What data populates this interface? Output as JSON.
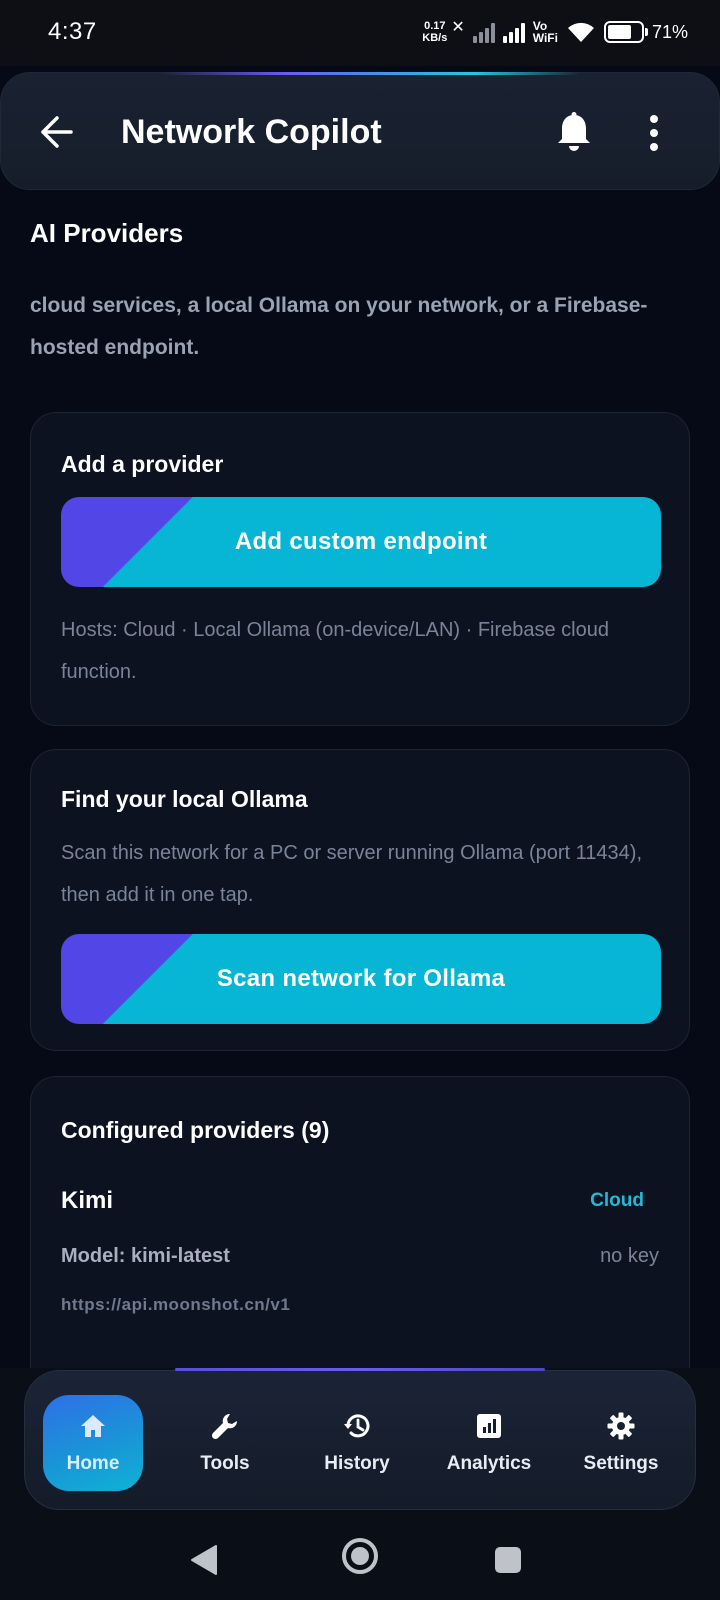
{
  "status_bar": {
    "time": "4:37",
    "net_speed_value": "0.17",
    "net_speed_unit": "KB/s",
    "vowifi_top": "Vo",
    "vowifi_bottom": "WiFi",
    "battery_percent": "71%",
    "battery_level": 0.71
  },
  "app_bar": {
    "title": "Network Copilot",
    "icons": [
      "back-arrow-icon",
      "bell-icon",
      "more-vert-icon"
    ]
  },
  "providers": {
    "section_title": "AI Providers",
    "intro": "cloud services, a local Ollama on your network, or a Firebase-hosted endpoint."
  },
  "add_card": {
    "title": "Add a provider",
    "button_label": "Add custom endpoint",
    "note": "Hosts: Cloud · Local Ollama (on-device/LAN) · Firebase cloud function."
  },
  "ollama_card": {
    "title": "Find your local Ollama",
    "note": "Scan this network for a PC or server running Ollama (port 11434), then add it in one tap.",
    "button_label": "Scan network for Ollama"
  },
  "configured": {
    "title": "Configured providers (9)",
    "items": [
      {
        "name": "Kimi",
        "badge": "Cloud",
        "model": "Model: kimi-latest",
        "key_status": "no key",
        "url": "https://api.moonshot.cn/v1"
      }
    ]
  },
  "bottom_nav": {
    "items": [
      {
        "label": "Home",
        "icon": "home-icon",
        "active": true
      },
      {
        "label": "Tools",
        "icon": "wrench-icon",
        "active": false
      },
      {
        "label": "History",
        "icon": "history-icon",
        "active": false
      },
      {
        "label": "Analytics",
        "icon": "analytics-icon",
        "active": false
      },
      {
        "label": "Settings",
        "icon": "gear-icon",
        "active": false
      }
    ]
  },
  "colors": {
    "background": "#050a16",
    "accent_cyan": "#06b6d4",
    "accent_indigo": "#5346e6",
    "card_background": "#0c1220",
    "muted_text": "#7a8498"
  }
}
